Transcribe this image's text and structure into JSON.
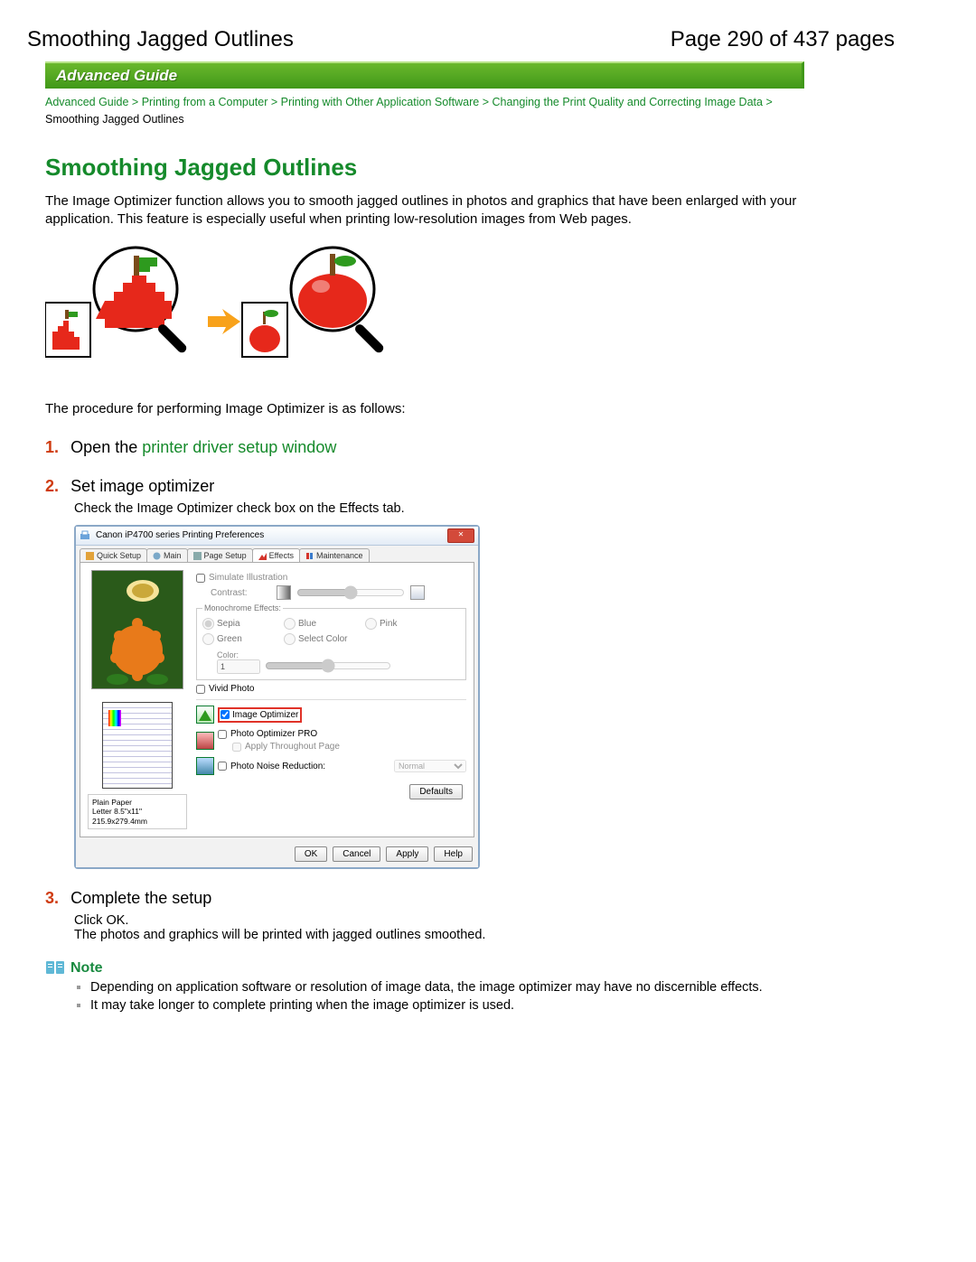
{
  "header": {
    "title": "Smoothing Jagged Outlines",
    "page_label": "Page 290 of 437 pages"
  },
  "banner": "Advanced Guide",
  "breadcrumb": {
    "items": [
      "Advanced Guide",
      "Printing from a Computer",
      "Printing with Other Application Software",
      "Changing the Print Quality and Correcting Image Data"
    ],
    "current": "Smoothing Jagged Outlines",
    "sep": ">"
  },
  "h1": "Smoothing Jagged Outlines",
  "intro": "The Image Optimizer function allows you to smooth jagged outlines in photos and graphics that have been enlarged with your application. This feature is especially useful when printing low-resolution images from Web pages.",
  "procedure_lead": "The procedure for performing Image Optimizer is as follows:",
  "steps": [
    {
      "num": "1.",
      "prefix": "Open the ",
      "link": "printer driver setup window"
    },
    {
      "num": "2.",
      "title": "Set image optimizer",
      "body": "Check the Image Optimizer check box on the Effects tab."
    },
    {
      "num": "3.",
      "title": "Complete the setup",
      "body1": "Click OK.",
      "body2": "The photos and graphics will be printed with jagged outlines smoothed."
    }
  ],
  "dialog": {
    "title": "Canon iP4700 series Printing Preferences",
    "close_btn_text": "✕",
    "tabs": [
      "Quick Setup",
      "Main",
      "Page Setup",
      "Effects",
      "Maintenance"
    ],
    "active_tab": 3,
    "effects": {
      "simulate": "Simulate Illustration",
      "contrast": "Contrast:",
      "mono_group": "Monochrome Effects:",
      "radios": [
        "Sepia",
        "Blue",
        "Pink",
        "Green",
        "Select Color"
      ],
      "color_lbl": "Color:",
      "color_val": "1",
      "vivid": "Vivid Photo",
      "image_opt": "Image Optimizer",
      "photo_opt": "Photo Optimizer PRO",
      "apply_page": "Apply Throughout Page",
      "noise": "Photo Noise Reduction:",
      "noise_sel": "Normal",
      "media1": "Plain Paper",
      "media2": "Letter 8.5\"x11\" 215.9x279.4mm",
      "defaults": "Defaults"
    },
    "buttons": [
      "OK",
      "Cancel",
      "Apply",
      "Help"
    ]
  },
  "note": {
    "label": "Note",
    "items": [
      "Depending on application software or resolution of image data, the image optimizer may have no discernible effects.",
      "It may take longer to complete printing when the image optimizer is used."
    ]
  }
}
